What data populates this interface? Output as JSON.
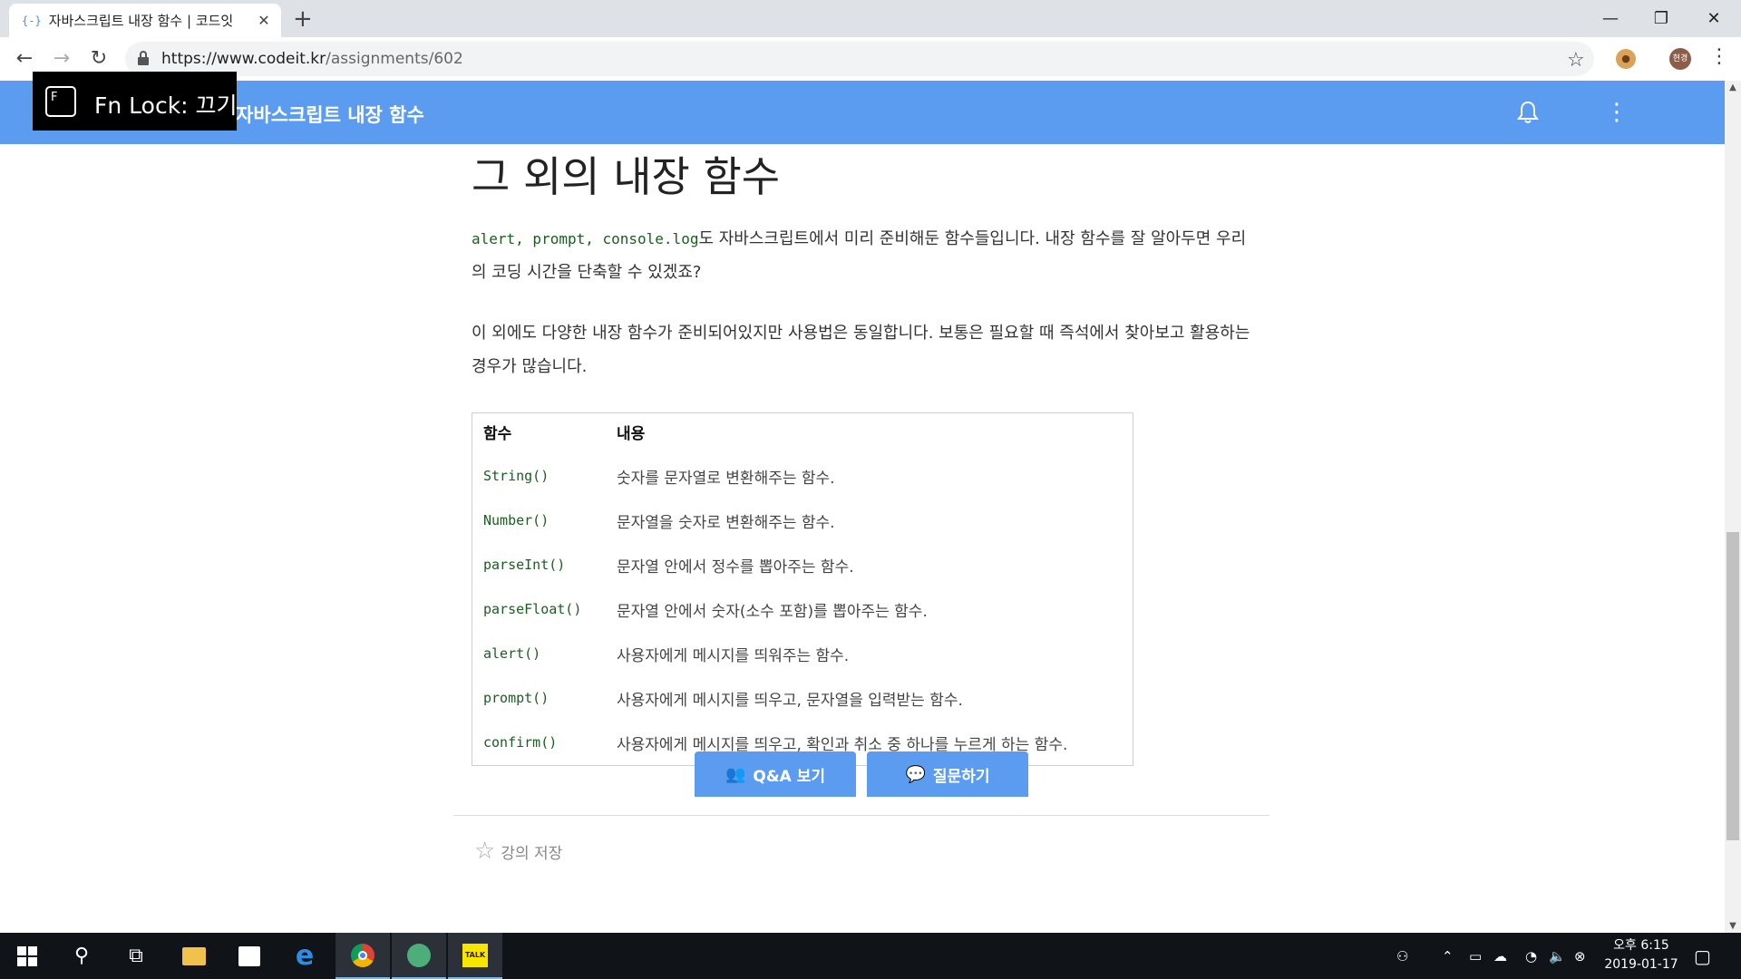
{
  "browser": {
    "tab_title": "자바스크립트 내장 함수 | 코드잇",
    "tab_favicon": "{-}",
    "url_domain": "https://www.codeit.kr",
    "url_path": "/assignments/602",
    "profile_initials": "현경"
  },
  "site": {
    "header_title": "자바스크립트 내장 함수",
    "accent_color": "#5b9cf0"
  },
  "overlay": {
    "fn_key": "F",
    "fn_lock_text": "Fn Lock: 끄기"
  },
  "content": {
    "heading": "그 외의 내장 함수",
    "para1_code": "alert, prompt, console.log",
    "para1_text": "도 자바스크립트에서 미리 준비해둔 함수들입니다. 내장 함수를 잘 알아두면 우리의 코딩 시간을 단축할 수 있겠죠?",
    "para2": "이 외에도 다양한 내장 함수가 준비되어있지만 사용법은 동일합니다. 보통은 필요할 때 즉석에서 찾아보고 활용하는 경우가 많습니다.",
    "table": {
      "headers": [
        "함수",
        "내용"
      ],
      "rows": [
        [
          "String()",
          "숫자를 문자열로 변환해주는 함수."
        ],
        [
          "Number()",
          "문자열을 숫자로 변환해주는 함수."
        ],
        [
          "parseInt()",
          "문자열 안에서 정수를 뽑아주는 함수."
        ],
        [
          "parseFloat()",
          "문자열 안에서 숫자(소수 포함)를 뽑아주는 함수."
        ],
        [
          "alert()",
          "사용자에게 메시지를 띄워주는 함수."
        ],
        [
          "prompt()",
          "사용자에게 메시지를 띄우고, 문자열을 입력받는 함수."
        ],
        [
          "confirm()",
          "사용자에게 메시지를 띄우고, 확인과 취소 중 하나를 누르게 하는 함수."
        ]
      ]
    },
    "save_label": "강의 저장",
    "qa_button": "Q&A 보기",
    "ask_button": "질문하기"
  },
  "taskbar": {
    "clock_ampm_time": "오후 6:15",
    "clock_date": "2019-01-17"
  }
}
